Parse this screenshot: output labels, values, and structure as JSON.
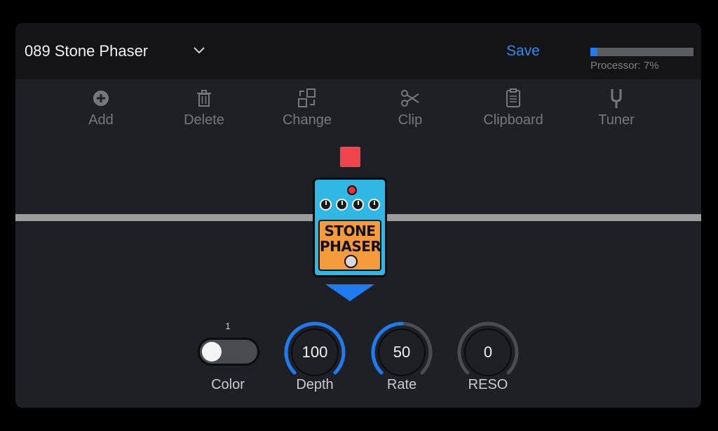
{
  "header": {
    "preset_name": "089 Stone Phaser",
    "save_label": "Save",
    "processor_label": "Processor: 7%",
    "processor_percent": 7
  },
  "toolbar": {
    "items": [
      {
        "label": "Add",
        "icon": "add-icon"
      },
      {
        "label": "Delete",
        "icon": "trash-icon"
      },
      {
        "label": "Change",
        "icon": "swap-icon"
      },
      {
        "label": "Clip",
        "icon": "scissors-icon"
      },
      {
        "label": "Clipboard",
        "icon": "clipboard-icon"
      },
      {
        "label": "Tuner",
        "icon": "tuning-fork-icon"
      }
    ]
  },
  "pedal": {
    "title_line1": "STONE",
    "title_line2": "PHASER",
    "color": "#31b7e3",
    "panel_color": "#f59b3c"
  },
  "params": {
    "color": {
      "label": "Color",
      "value": "1",
      "on": false
    },
    "depth": {
      "label": "Depth",
      "value": "100",
      "fraction": 1.0
    },
    "rate": {
      "label": "Rate",
      "value": "50",
      "fraction": 0.5
    },
    "reso": {
      "label": "RESO",
      "value": "0",
      "fraction": 0.0
    }
  },
  "colors": {
    "accent": "#1e7cf0",
    "save_text": "#2a8cf0",
    "stop": "#f0444a"
  }
}
